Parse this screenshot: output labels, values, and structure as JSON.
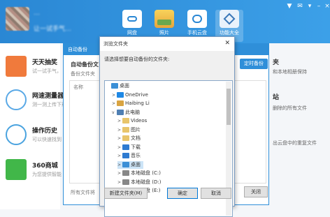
{
  "app": {
    "nickname": "…",
    "subtitle": "让一试手气…",
    "top_buttons": [
      {
        "label": "网盘"
      },
      {
        "label": "照片"
      },
      {
        "label": "手机云盘"
      },
      {
        "label": "功能大全"
      }
    ]
  },
  "sidebar": {
    "items": [
      {
        "title": "天天抽奖",
        "desc": "试一试手气，",
        "color": "#f07a3c"
      },
      {
        "title": "网速测量器",
        "desc": "测一测上传下载",
        "color": "#5aa9e6"
      },
      {
        "title": "操作历史",
        "desc": "可以快速找到",
        "color": "#4aa3df"
      },
      {
        "title": "360商城",
        "desc": "为您提供智能",
        "color": "#41b749"
      }
    ]
  },
  "right_panel": {
    "heading1": "夹",
    "line1": "和本地相册保持",
    "heading2": "站",
    "line2": "删除的所有文件",
    "line3": "出云盘中的重复文件"
  },
  "backup_dialog": {
    "title": "自动备份",
    "section_title": "自动备份文",
    "desc": "备份文件夹",
    "list_header": "名称",
    "footer": "所有文件将",
    "add_button": "定时备份",
    "close_button": "关闭"
  },
  "folder_dialog": {
    "title": "浏览文件夹",
    "prompt": "请选择想要自动备份的文件夹:",
    "tree": [
      {
        "label": "桌面",
        "level": 0,
        "expander": "",
        "icon": "desktop-icon",
        "color": "#3b8fd6"
      },
      {
        "label": "OneDrive",
        "level": 1,
        "expander": ">",
        "icon": "cloud-icon",
        "color": "#1e88e5"
      },
      {
        "label": "Haibing Li",
        "level": 1,
        "expander": ">",
        "icon": "user-icon",
        "color": "#d9a441"
      },
      {
        "label": "此电脑",
        "level": 1,
        "expander": "v",
        "icon": "computer-icon",
        "color": "#4f7fb3"
      },
      {
        "label": "Videos",
        "level": 2,
        "expander": ">",
        "icon": "folder-icon",
        "color": "#e8c56a"
      },
      {
        "label": "图片",
        "level": 2,
        "expander": ">",
        "icon": "pictures-icon",
        "color": "#e8c56a"
      },
      {
        "label": "文档",
        "level": 2,
        "expander": ">",
        "icon": "documents-icon",
        "color": "#e8c56a"
      },
      {
        "label": "下载",
        "level": 2,
        "expander": ">",
        "icon": "download-icon",
        "color": "#2e7bd1"
      },
      {
        "label": "音乐",
        "level": 2,
        "expander": ">",
        "icon": "music-icon",
        "color": "#2e7bd1"
      },
      {
        "label": "桌面",
        "level": 2,
        "expander": ">",
        "icon": "desktop-icon",
        "color": "#3b8fd6",
        "selected": true
      },
      {
        "label": "本地磁盘 (C:)",
        "level": 2,
        "expander": ">",
        "icon": "drive-icon",
        "color": "#888"
      },
      {
        "label": "本地磁盘 (D:)",
        "level": 2,
        "expander": ">",
        "icon": "drive-icon",
        "color": "#888"
      },
      {
        "label": "本地磁盘 (E:)",
        "level": 2,
        "expander": ">",
        "icon": "drive-icon",
        "color": "#888"
      }
    ],
    "new_folder": "新建文件夹(M)",
    "ok": "确定",
    "cancel": "取消"
  }
}
